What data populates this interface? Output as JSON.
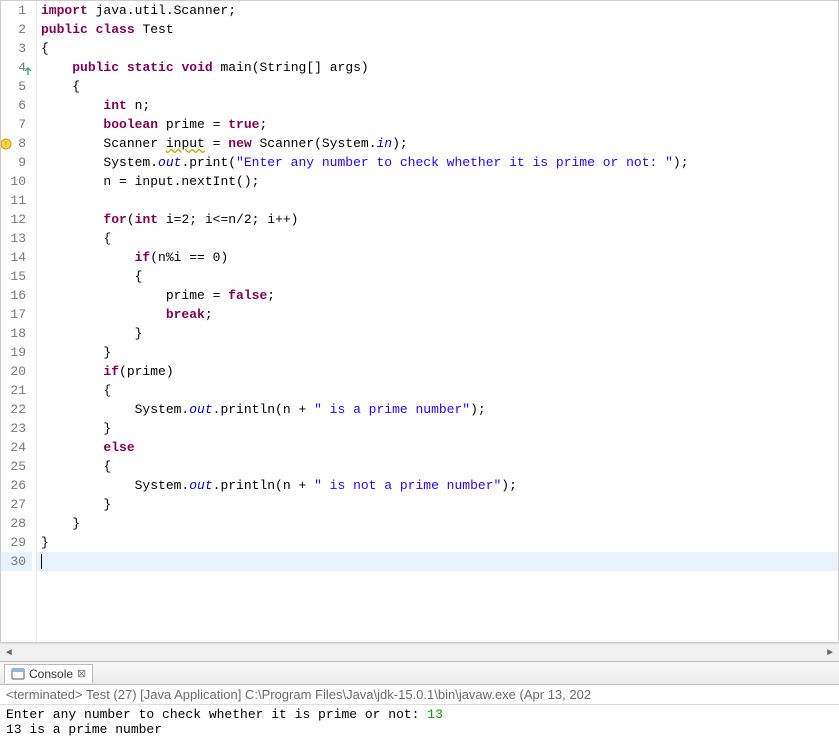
{
  "editor": {
    "lines": [
      {
        "n": 1
      },
      {
        "n": 2
      },
      {
        "n": 3
      },
      {
        "n": 4,
        "annot": "override"
      },
      {
        "n": 5
      },
      {
        "n": 6
      },
      {
        "n": 7
      },
      {
        "n": 8,
        "annot": "warning"
      },
      {
        "n": 9
      },
      {
        "n": 10
      },
      {
        "n": 11
      },
      {
        "n": 12
      },
      {
        "n": 13
      },
      {
        "n": 14
      },
      {
        "n": 15
      },
      {
        "n": 16
      },
      {
        "n": 17
      },
      {
        "n": 18
      },
      {
        "n": 19
      },
      {
        "n": 20
      },
      {
        "n": 21
      },
      {
        "n": 22
      },
      {
        "n": 23
      },
      {
        "n": 24
      },
      {
        "n": 25
      },
      {
        "n": 26
      },
      {
        "n": 27
      },
      {
        "n": 28
      },
      {
        "n": 29
      },
      {
        "n": 30,
        "current": true
      }
    ],
    "code": {
      "l1": {
        "pre": "",
        "kw1": "import",
        "mid": " java.util.Scanner;"
      },
      "l2": {
        "kw1": "public",
        "sp1": " ",
        "kw2": "class",
        "sp2": " ",
        "name": "Test"
      },
      "l3": {
        "txt": "{"
      },
      "l4": {
        "indent": "    ",
        "kw1": "public",
        "sp1": " ",
        "kw2": "static",
        "sp2": " ",
        "kw3": "void",
        "sp3": " ",
        "name": "main(String[] args)"
      },
      "l5": {
        "indent": "    ",
        "txt": "{"
      },
      "l6": {
        "indent": "        ",
        "kw": "int",
        "rest": " n;"
      },
      "l7": {
        "indent": "        ",
        "kw1": "boolean",
        "mid": " prime = ",
        "kw2": "true",
        "end": ";"
      },
      "l8": {
        "indent": "        ",
        "a": "Scanner ",
        "warn": "input",
        "b": " = ",
        "kw": "new",
        "c": " Scanner(System.",
        "fld": "in",
        "d": ");"
      },
      "l9": {
        "indent": "        ",
        "a": "System.",
        "fld": "out",
        "b": ".print(",
        "str": "\"Enter any number to check whether it is prime or not: \"",
        "c": ");"
      },
      "l10": {
        "indent": "        ",
        "txt": "n = input.nextInt();"
      },
      "l11": {
        "txt": ""
      },
      "l12": {
        "indent": "        ",
        "kw1": "for",
        "a": "(",
        "kw2": "int",
        "b": " i=2; i<=n/2; i++)"
      },
      "l13": {
        "indent": "        ",
        "txt": "{"
      },
      "l14": {
        "indent": "            ",
        "kw": "if",
        "rest": "(n%i == 0)"
      },
      "l15": {
        "indent": "            ",
        "txt": "{"
      },
      "l16": {
        "indent": "                ",
        "a": "prime = ",
        "kw": "false",
        "b": ";"
      },
      "l17": {
        "indent": "                ",
        "kw": "break",
        "b": ";"
      },
      "l18": {
        "indent": "            ",
        "txt": "}"
      },
      "l19": {
        "indent": "        ",
        "txt": "}"
      },
      "l20": {
        "indent": "        ",
        "kw": "if",
        "rest": "(prime)"
      },
      "l21": {
        "indent": "        ",
        "txt": "{"
      },
      "l22": {
        "indent": "            ",
        "a": "System.",
        "fld": "out",
        "b": ".println(n + ",
        "str": "\" is a prime number\"",
        "c": ");"
      },
      "l23": {
        "indent": "        ",
        "txt": "}"
      },
      "l24": {
        "indent": "        ",
        "kw": "else"
      },
      "l25": {
        "indent": "        ",
        "txt": "{"
      },
      "l26": {
        "indent": "            ",
        "a": "System.",
        "fld": "out",
        "b": ".println(n + ",
        "str": "\" is not a prime number\"",
        "c": ");"
      },
      "l27": {
        "indent": "        ",
        "txt": "}"
      },
      "l28": {
        "indent": "    ",
        "txt": "}"
      },
      "l29": {
        "txt": "}"
      },
      "l30": {
        "txt": ""
      }
    }
  },
  "console": {
    "tab_label": "Console",
    "status": "<terminated> Test (27) [Java Application] C:\\Program Files\\Java\\jdk-15.0.1\\bin\\javaw.exe  (Apr 13, 202",
    "prompt": "Enter any number to check whether it is prime or not: ",
    "input": "13",
    "result": "13 is a prime number"
  }
}
